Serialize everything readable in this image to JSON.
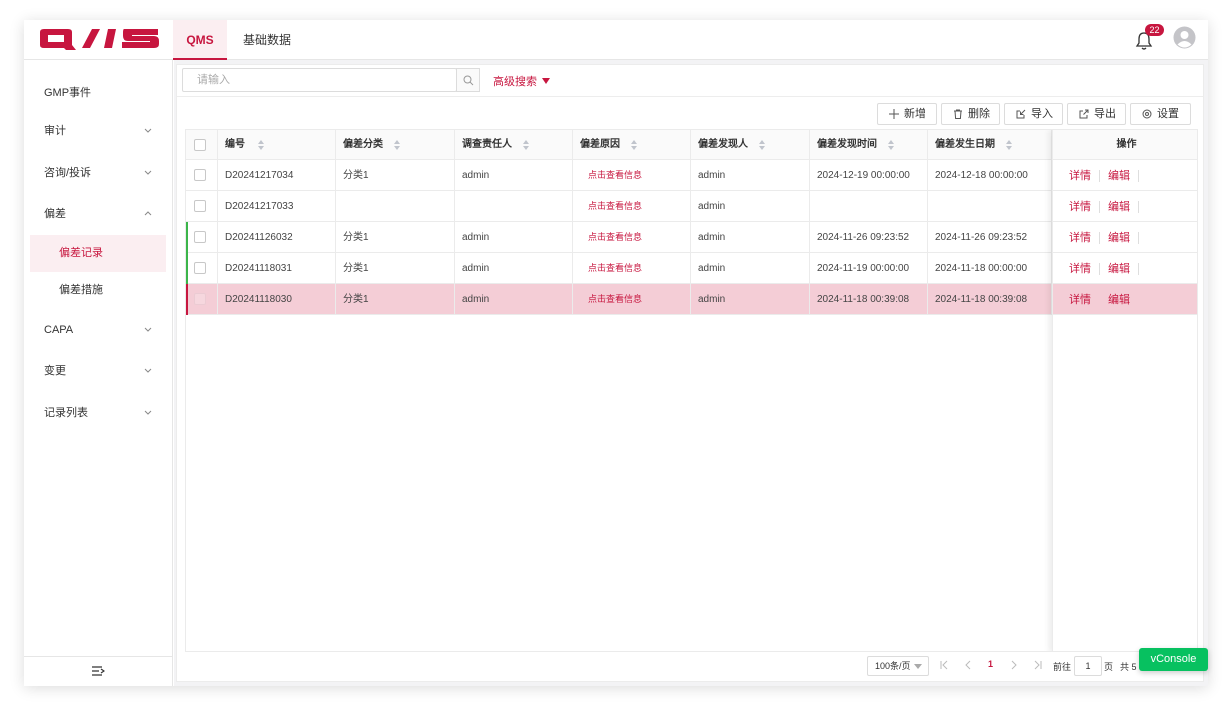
{
  "header": {
    "logo_text": "QMS",
    "tabs": [
      {
        "label": "QMS",
        "active": true
      },
      {
        "label": "基础数据",
        "active": false
      }
    ],
    "notification_count": "22",
    "icons": [
      "bell-icon",
      "avatar-icon"
    ]
  },
  "sidebar": {
    "items": [
      {
        "label": "GMP事件",
        "has_chevron": false
      },
      {
        "label": "审计",
        "has_chevron": true,
        "expanded": false
      },
      {
        "label": "咨询/投诉",
        "has_chevron": true,
        "expanded": false
      },
      {
        "label": "偏差",
        "has_chevron": true,
        "expanded": true
      },
      {
        "label": "CAPA",
        "has_chevron": true,
        "expanded": false
      },
      {
        "label": "变更",
        "has_chevron": true,
        "expanded": false
      },
      {
        "label": "记录列表",
        "has_chevron": true,
        "expanded": false
      }
    ],
    "sub_items": [
      {
        "label": "偏差记录",
        "active": true
      },
      {
        "label": "偏差措施",
        "active": false
      }
    ],
    "collapse_icon": "collapse-menu-icon"
  },
  "search": {
    "placeholder": "请输入",
    "advanced_label": "高级搜索"
  },
  "toolbar": {
    "add": "新增",
    "delete": "删除",
    "import": "导入",
    "export": "导出",
    "settings": "设置"
  },
  "table": {
    "columns": [
      "编号",
      "偏差分类",
      "调查责任人",
      "偏差原因",
      "偏差发现人",
      "偏差发现时间",
      "偏差发生日期"
    ],
    "action_header": "操作",
    "action_labels": {
      "detail": "详情",
      "edit": "编辑"
    },
    "rows": [
      {
        "id": "D20241217034",
        "category": "分类1",
        "investigator": "admin",
        "reason": "点击查看信息",
        "finder": "admin",
        "found_time": "2024-12-19 00:00:00",
        "occur_date": "2024-12-18 00:00:00",
        "marker": "none",
        "selected": false
      },
      {
        "id": "D20241217033",
        "category": "",
        "investigator": "",
        "reason": "点击查看信息",
        "finder": "admin",
        "found_time": "",
        "occur_date": "",
        "marker": "none",
        "selected": false
      },
      {
        "id": "D20241126032",
        "category": "分类1",
        "investigator": "admin",
        "reason": "点击查看信息",
        "finder": "admin",
        "found_time": "2024-11-26 09:23:52",
        "occur_date": "2024-11-26 09:23:52",
        "marker": "#3bb54a",
        "selected": false
      },
      {
        "id": "D20241118031",
        "category": "分类1",
        "investigator": "admin",
        "reason": "点击查看信息",
        "finder": "admin",
        "found_time": "2024-11-19 00:00:00",
        "occur_date": "2024-11-18 00:00:00",
        "marker": "#3bb54a",
        "selected": false
      },
      {
        "id": "D20241118030",
        "category": "分类1",
        "investigator": "admin",
        "reason": "点击查看信息",
        "finder": "admin",
        "found_time": "2024-11-18 00:39:08",
        "occur_date": "2024-11-18 00:39:08",
        "marker": "#c7163f",
        "selected": true
      }
    ]
  },
  "pagination": {
    "page_size": "100条/页",
    "current_page": "1",
    "goto_label": "前往",
    "goto_value": "1",
    "page_unit": "页",
    "total_text": "共 5"
  },
  "vconsole": "vConsole",
  "colors": {
    "brand": "#c7163f",
    "selected_row": "#f4cdd6",
    "active_bg": "#fbeef1",
    "marker_green": "#3bb54a",
    "vconsole_green": "#07c160"
  }
}
